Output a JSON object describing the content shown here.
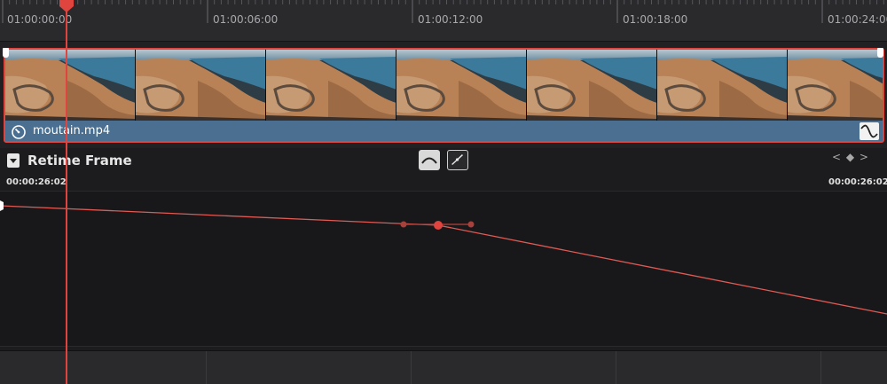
{
  "ruler": {
    "timecodes": [
      "01:00:00:00",
      "01:00:06:00",
      "01:00:12:00",
      "01:00:18:00",
      "01:00:24:00"
    ]
  },
  "clip": {
    "name": "moutain.mp4",
    "thumbnail_count": 7
  },
  "retime": {
    "title": "Retime Frame",
    "start_time": "00:00:26:02",
    "end_time": "00:00:26:02",
    "keyframe_nav": "< ◆ >"
  },
  "icons": {
    "collapse": "collapse-triangle-icon",
    "speed": "speedometer-icon",
    "curve_badge": "curve-icon",
    "ease": "ease-curve-icon",
    "linear": "linear-curve-icon"
  },
  "colors": {
    "accent": "#e0443e",
    "clip": "#4a6f90",
    "background": "#1c1c1e"
  }
}
